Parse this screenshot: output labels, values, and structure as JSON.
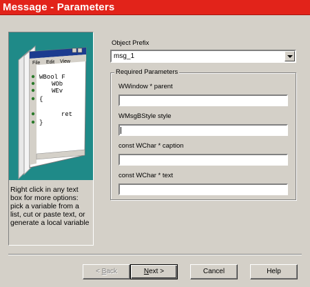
{
  "window": {
    "title": "Message - Parameters"
  },
  "side": {
    "help_text": "Right click in any text box for more options: pick a variable from a list, cut or paste text, or generate a local variable",
    "illustration": {
      "menu": [
        "File",
        "Edit",
        "View"
      ],
      "code_lines": [
        "WBool F",
        "WOb",
        "WEv",
        "{",
        "ret",
        "}"
      ]
    }
  },
  "form": {
    "object_prefix_label": "Object Prefix",
    "object_prefix_value": "msg_1",
    "group_title": "Required Parameters",
    "params": [
      {
        "label": "WWindow * parent",
        "value": ""
      },
      {
        "label": "WMsgBStyle style",
        "value": ""
      },
      {
        "label": "const WChar * caption",
        "value": ""
      },
      {
        "label": "const WChar * text",
        "value": ""
      }
    ]
  },
  "buttons": {
    "back": {
      "prefix": "< ",
      "underlined": "B",
      "rest": "ack"
    },
    "next": {
      "underlined": "N",
      "rest": "ext >"
    },
    "cancel": "Cancel",
    "help": "Help"
  }
}
